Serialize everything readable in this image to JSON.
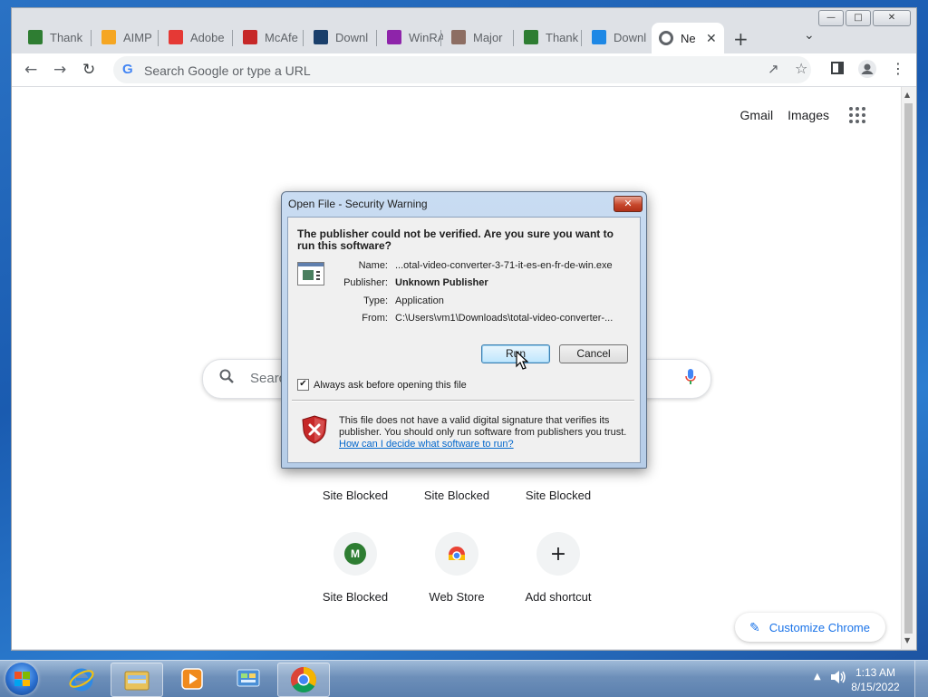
{
  "browser": {
    "tabs": [
      {
        "title": "Thank",
        "favicon": "green-download-icon",
        "color": "#2e7d32"
      },
      {
        "title": "AIMP",
        "favicon": "aimp-icon",
        "color": "#f5a623"
      },
      {
        "title": "Adobe",
        "favicon": "adobe-icon",
        "color": "#e53935"
      },
      {
        "title": "McAfe",
        "favicon": "mcafee-icon",
        "color": "#c62828"
      },
      {
        "title": "Downl",
        "favicon": "download-site-icon",
        "color": "#1a3f6b"
      },
      {
        "title": "WinRA",
        "favicon": "winrar-icon",
        "color": "#8e24aa"
      },
      {
        "title": "Major",
        "favicon": "majorgeeks-icon",
        "color": "#8d6e63"
      },
      {
        "title": "Thank",
        "favicon": "green-download-icon",
        "color": "#2e7d32"
      },
      {
        "title": "Downl",
        "favicon": "softonic-icon",
        "color": "#1e88e5"
      },
      {
        "title": "Ne",
        "favicon": "chrome-icon",
        "color": "#5f6368",
        "active": true
      }
    ],
    "omnibox_placeholder": "Search Google or type a URL",
    "toplinks": {
      "gmail": "Gmail",
      "images": "Images"
    },
    "search_placeholder": "Searc",
    "shortcuts_row1": [
      "Site Blocked",
      "Site Blocked",
      "Site Blocked"
    ],
    "shortcuts_row2": [
      {
        "label": "Site Blocked",
        "tile": "M",
        "tile_color": "#2e7d32"
      },
      {
        "label": "Web Store",
        "tile": "webstore-icon"
      },
      {
        "label": "Add shortcut",
        "tile": "+"
      }
    ],
    "customize_label": "Customize Chrome"
  },
  "dialog": {
    "title": "Open File - Security Warning",
    "heading": "The publisher could not be verified.  Are you sure you want to run this software?",
    "fields": [
      {
        "key": "Name:",
        "value": "...otal-video-converter-3-71-it-es-en-fr-de-win.exe",
        "bold": false
      },
      {
        "key": "Publisher:",
        "value": "Unknown Publisher",
        "bold": true
      },
      {
        "key": "Type:",
        "value": "Application",
        "bold": false
      },
      {
        "key": "From:",
        "value": "C:\\Users\\vm1\\Downloads\\total-video-converter-...",
        "bold": false
      }
    ],
    "run_label": "Run",
    "cancel_label": "Cancel",
    "checkbox_label": "Always ask before opening this file",
    "checkbox_checked": true,
    "warning_text": "This file does not have a valid digital signature that verifies its publisher.  You should only run software from publishers you trust.",
    "warning_link": "How can I decide what software to run?"
  },
  "taskbar": {
    "time": "1:13 AM",
    "date": "8/15/2022"
  }
}
